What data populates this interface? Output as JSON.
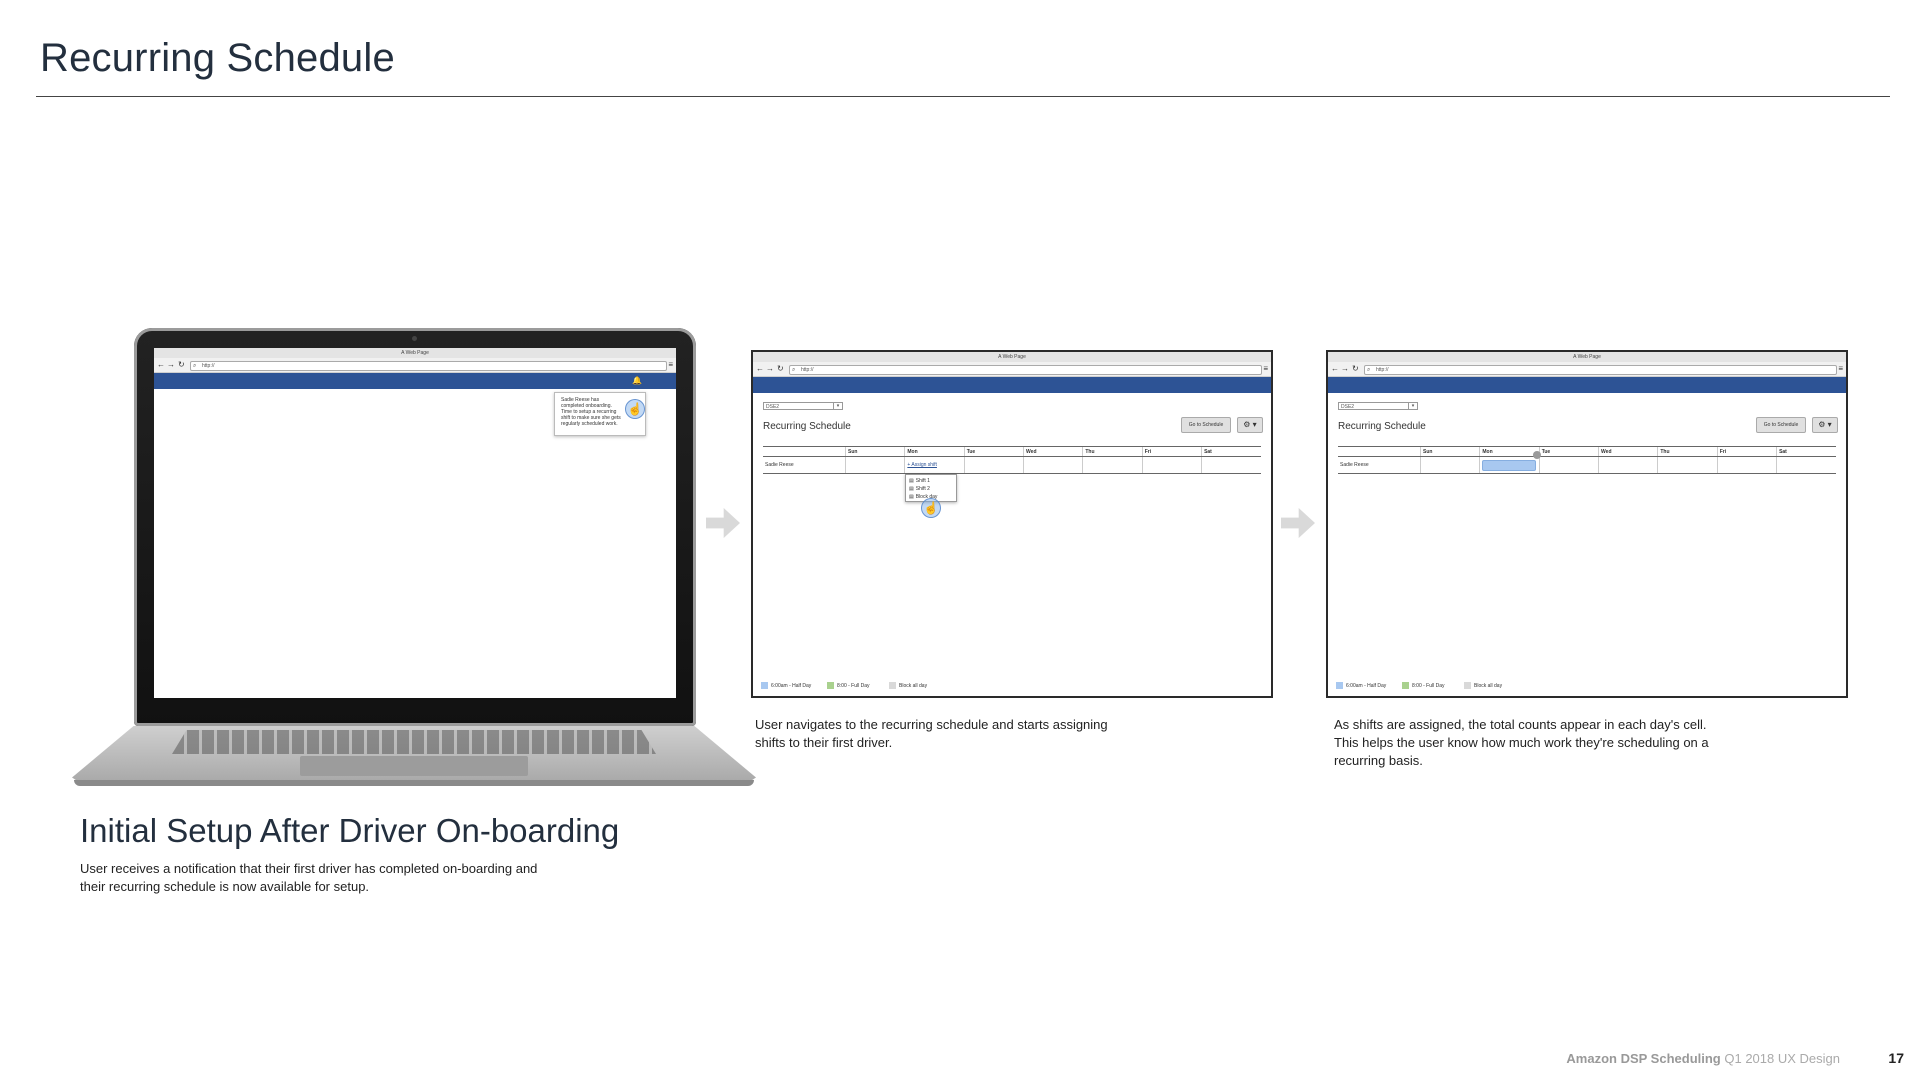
{
  "slide": {
    "title": "Recurring Schedule",
    "subtitle": "Initial Setup After Driver On-boarding",
    "subtitle_caption": "User receives a notification that their first driver has completed on-boarding and their recurring schedule is now available for setup."
  },
  "browser": {
    "window_title": "A Web Page",
    "url": "http://",
    "back_icon": "arrow-left-icon",
    "forward_icon": "arrow-right-icon",
    "reload_icon": "reload-icon",
    "menu_icon": "hamburger-icon"
  },
  "screen1": {
    "notification_text": "Sadie Reese has completed onboarding. Time to setup a recurring shift to make sure she gets regularly scheduled work.",
    "notification_icon": "bell-icon"
  },
  "schedule": {
    "station": "DSE2",
    "heading": "Recurring Schedule",
    "goto_button": "Go to Schedule",
    "columns": [
      "",
      "Sun",
      "Mon",
      "Tue",
      "Wed",
      "Thu",
      "Fri",
      "Sat"
    ],
    "driver": "Sadie Reese",
    "assign_link": "+ Assign shift",
    "popup_items": [
      "Shift 1",
      "Shift 2",
      "Block day"
    ],
    "legend": [
      "6:00am - Half Day",
      "8:00 - Full Day",
      "Block all day"
    ],
    "legend_colors": [
      "#a8c8f0",
      "#a9d18e",
      "#d9d9d9"
    ],
    "count_badge": ""
  },
  "captions": {
    "step2": "User navigates to the recurring schedule and starts assigning shifts to their first driver.",
    "step3": "As shifts are assigned, the total counts appear in each day's cell. This helps the user know how much work they're scheduling on a recurring basis."
  },
  "footer": {
    "brand": "Amazon DSP Scheduling",
    "descriptor": "Q1 2018 UX Design",
    "page_number": "17"
  },
  "colors": {
    "header_blue": "#2d5395",
    "title_text": "#232f3e"
  }
}
